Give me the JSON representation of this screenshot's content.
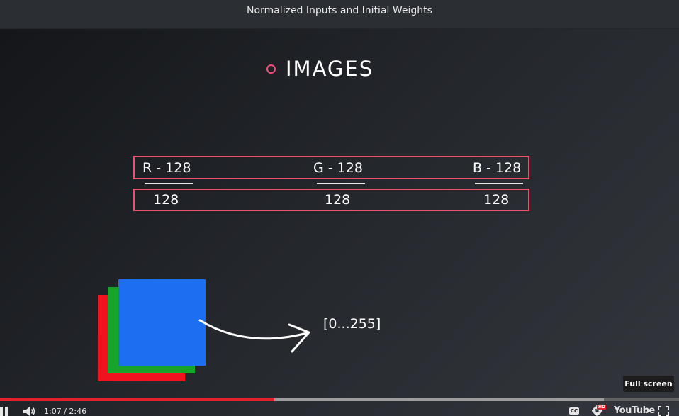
{
  "window": {
    "title": "Normalized Inputs and Initial Weights"
  },
  "slide": {
    "heading": "IMAGES",
    "numerators": [
      "R - 128",
      "G - 128",
      "B - 128"
    ],
    "denominators": [
      "128",
      "128",
      "128"
    ],
    "range_label": "[0...255]",
    "square_colors": [
      "#f0121f",
      "#16a52a",
      "#1e6ef2"
    ]
  },
  "player": {
    "tooltip": "Full screen",
    "time_display": "1:07 / 2:46",
    "progress_fraction": 0.404,
    "buffered_fraction": 0.889,
    "cc_label": "CC",
    "hd_badge": "HD",
    "logo": "YouTube",
    "accent_color": "#e1222a",
    "icons": [
      "pause-icon",
      "volume-icon",
      "cc-icon",
      "gear-icon",
      "fullscreen-icon"
    ]
  }
}
